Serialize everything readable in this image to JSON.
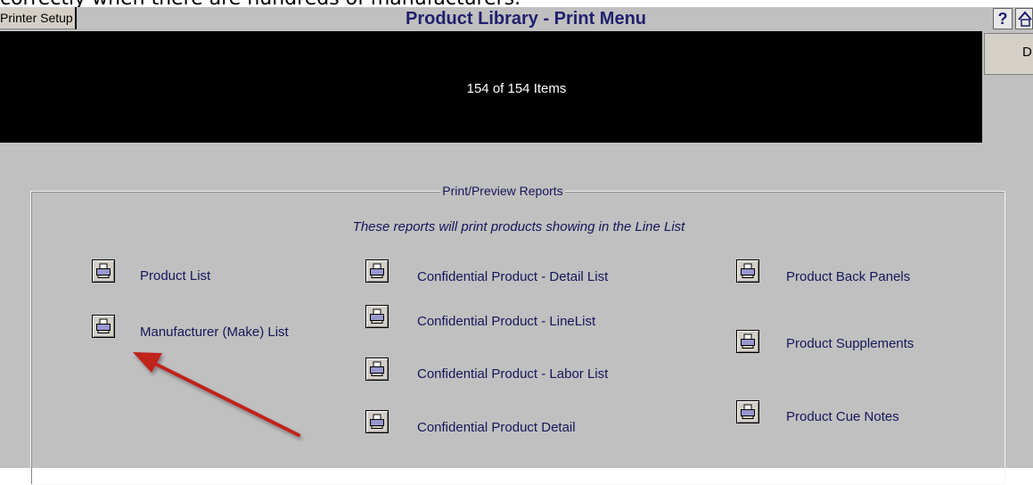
{
  "caption": {
    "text": "correctly when there are hundreds of manufacturers."
  },
  "titlebar": {
    "setup_label": "Printer Setup",
    "title": "Product Library - Print Menu",
    "help_label": "?"
  },
  "header": {
    "item_count": "154 of 154 Items",
    "side_button_label": "D"
  },
  "reports": {
    "group_title": "Print/Preview Reports",
    "subtitle": "These reports will print products showing in the Line List",
    "items": [
      {
        "label": "Product List"
      },
      {
        "label": "Manufacturer (Make) List"
      },
      {
        "label": "Confidential Product - Detail List"
      },
      {
        "label": "Confidential Product - LineList"
      },
      {
        "label": "Confidential Product - Labor List"
      },
      {
        "label": "Confidential Product Detail"
      },
      {
        "label": "Product Back Panels"
      },
      {
        "label": "Product Supplements"
      },
      {
        "label": "Product Cue Notes"
      }
    ]
  },
  "icons": {
    "print": "printer-icon",
    "help": "help-icon",
    "home": "home-icon",
    "annotation": "arrow"
  },
  "colors": {
    "background": "#c0c0c0",
    "header_bar": "#000000",
    "label_text": "#16165a",
    "annotation_arrow": "#c0201e"
  }
}
